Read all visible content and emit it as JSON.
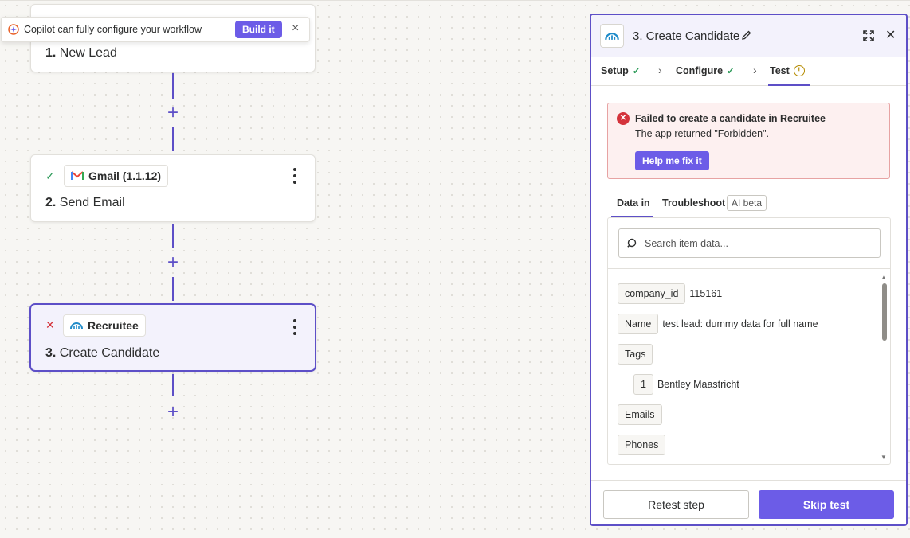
{
  "copilot": {
    "text": "Copilot can fully configure your workflow",
    "build_label": "Build it",
    "close_label": "×"
  },
  "nodes": [
    {
      "number": "1.",
      "title": "New Lead"
    },
    {
      "number": "2.",
      "title": "Send Email",
      "app": "Gmail (1.1.12)",
      "status": "success"
    },
    {
      "number": "3.",
      "title": "Create Candidate",
      "app": "Recruitee",
      "status": "error"
    }
  ],
  "panel": {
    "title": "3. Create Candidate",
    "tabs": [
      {
        "label": "Setup",
        "state": "done"
      },
      {
        "label": "Configure",
        "state": "done"
      },
      {
        "label": "Test",
        "state": "warning"
      }
    ],
    "error": {
      "title": "Failed to create a candidate in Recruitee",
      "message": "The app returned \"Forbidden\".",
      "button": "Help me fix it"
    },
    "subtabs": {
      "data_in": "Data in",
      "troubleshoot": "Troubleshoot",
      "beta": "AI beta"
    },
    "search_placeholder": "Search item data...",
    "data_rows": [
      {
        "key": "company_id",
        "value": "115161"
      },
      {
        "key": "Name",
        "value": "test lead: dummy data for full name"
      },
      {
        "key": "Tags",
        "value": ""
      },
      {
        "key": "1",
        "value": "Bentley Maastricht"
      },
      {
        "key": "Emails",
        "value": ""
      },
      {
        "key": "Phones",
        "value": ""
      }
    ],
    "retest_label": "Retest step",
    "skip_label": "Skip test"
  },
  "colors": {
    "accent": "#6c5ce7",
    "connector": "#5d4fc7",
    "error": "#d4333b",
    "success": "#2e9b5a"
  }
}
